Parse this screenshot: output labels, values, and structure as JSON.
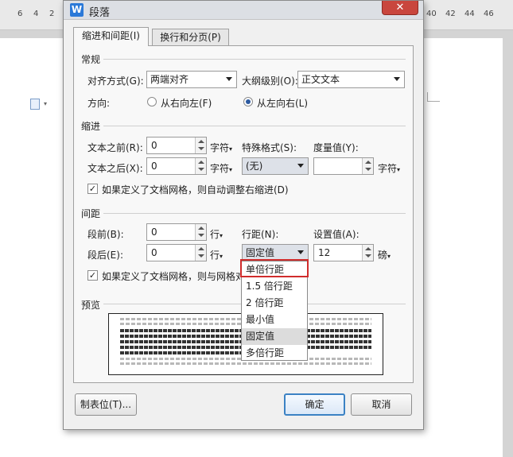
{
  "ruler": {
    "numbers_left": [
      "6",
      "4",
      "2"
    ],
    "numbers_right": [
      "40",
      "42",
      "44",
      "46"
    ]
  },
  "dialog": {
    "title": "段落",
    "app_icon": "W",
    "close_label": "✕",
    "tabs": [
      {
        "label": "缩进和间距(I)",
        "active": true
      },
      {
        "label": "换行和分页(P)",
        "active": false
      }
    ],
    "general": {
      "heading": "常规",
      "alignment_label": "对齐方式(G):",
      "alignment_value": "两端对齐",
      "outline_label": "大纲级别(O):",
      "outline_value": "正文文本",
      "direction_label": "方向:",
      "rtl_label": "从右向左(F)",
      "ltr_label": "从左向右(L)",
      "direction_selected": "ltr"
    },
    "indent": {
      "heading": "缩进",
      "before_label": "文本之前(R):",
      "before_value": "0",
      "before_unit": "字符",
      "after_label": "文本之后(X):",
      "after_value": "0",
      "after_unit": "字符",
      "special_label": "特殊格式(S):",
      "special_value": "(无)",
      "measure_label": "度量值(Y):",
      "measure_value": "",
      "measure_unit": "字符",
      "auto_adjust_label": "如果定义了文档网格，则自动调整右缩进(D)",
      "auto_adjust_checked": true
    },
    "spacing": {
      "heading": "间距",
      "before_label": "段前(B):",
      "before_value": "0",
      "before_unit": "行",
      "after_label": "段后(E):",
      "after_value": "0",
      "after_unit": "行",
      "line_label": "行距(N):",
      "line_value": "固定值",
      "setting_label": "设置值(A):",
      "setting_value": "12",
      "setting_unit": "磅",
      "grid_label": "如果定义了文档网格，则与网格对",
      "grid_checked": true
    },
    "preview": {
      "heading": "预览"
    },
    "buttons": {
      "tabs": "制表位(T)...",
      "ok": "确定",
      "cancel": "取消"
    },
    "line_spacing_options": [
      {
        "label": "单倍行距",
        "highlighted": true
      },
      {
        "label": "1.5 倍行距"
      },
      {
        "label": "2 倍行距"
      },
      {
        "label": "最小值"
      },
      {
        "label": "固定值",
        "selected": true
      },
      {
        "label": "多倍行距"
      }
    ]
  },
  "colors": {
    "accent": "#3b82c4",
    "highlight_box": "#d02c2c",
    "close": "#c9463d"
  }
}
